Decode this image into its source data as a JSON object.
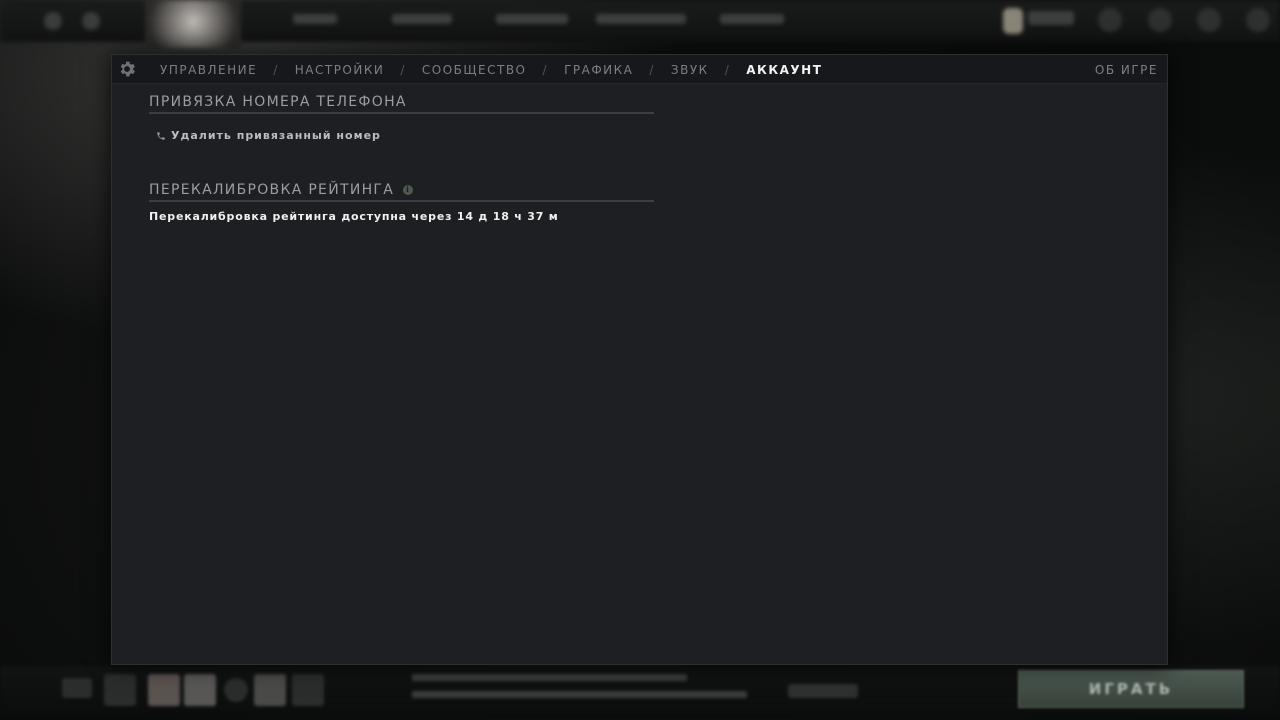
{
  "tabs": [
    {
      "label": "УПРАВЛЕНИЕ"
    },
    {
      "label": "НАСТРОЙКИ"
    },
    {
      "label": "СООБЩЕСТВО"
    },
    {
      "label": "ГРАФИКА"
    },
    {
      "label": "ЗВУК"
    },
    {
      "label": "АККАУНТ"
    }
  ],
  "tab_separator": "/",
  "active_tab": "АККАУНТ",
  "about_label": "ОБ ИГРЕ",
  "phone_section": {
    "title": "ПРИВЯЗКА НОМЕРА ТЕЛЕФОНА",
    "unlink_label": "Удалить привязанный номер"
  },
  "recalibration_section": {
    "title": "ПЕРЕКАЛИБРОВКА РЕЙТИНГА",
    "status_text": "Перекалибровка рейтинга доступна через 14 д 18 ч 37 м"
  },
  "background": {
    "play_label": "ИГРАТЬ"
  },
  "icons": {
    "settings": "gear-icon",
    "phone": "phone-icon",
    "info": "info-icon"
  },
  "colors": {
    "panel_bg": "#1d1f22",
    "tabs_bg": "#17181b",
    "active_tab": "#f2f2f2",
    "inactive_tab": "#7b7f84"
  }
}
